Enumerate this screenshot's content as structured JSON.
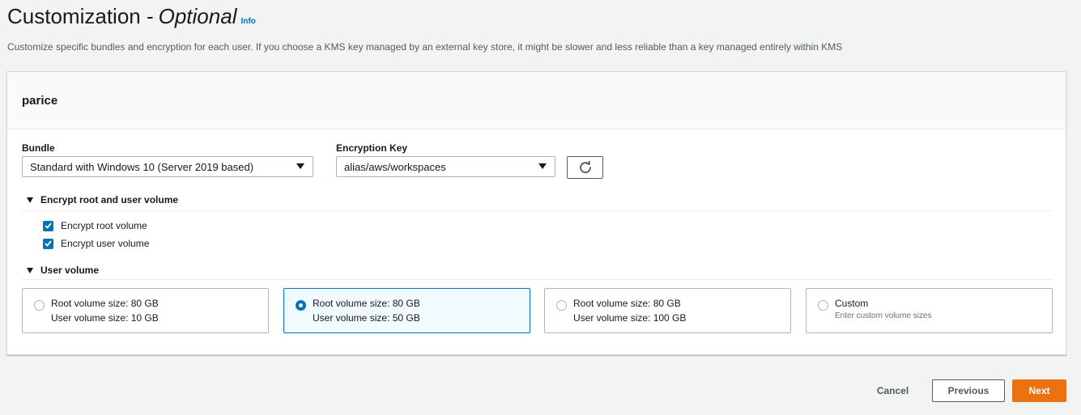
{
  "header": {
    "title": "Customization -",
    "title_optional": "Optional",
    "info_label": "Info",
    "description": "Customize specific bundles and encryption for each user. If you choose a KMS key managed by an external key store, it might be slower and less reliable than a key managed entirely within KMS"
  },
  "panel": {
    "user_name": "parice",
    "bundle": {
      "label": "Bundle",
      "value": "Standard with Windows 10 (Server 2019 based)"
    },
    "encryption_key": {
      "label": "Encryption Key",
      "value": "alias/aws/workspaces"
    },
    "encrypt_section": {
      "title": "Encrypt root and user volume",
      "expanded": true,
      "options": [
        {
          "label": "Encrypt root volume",
          "checked": true
        },
        {
          "label": "Encrypt user volume",
          "checked": true
        }
      ]
    },
    "volume_section": {
      "title": "User volume",
      "expanded": true,
      "tiles": [
        {
          "line1": "Root volume size: 80 GB",
          "line2": "User volume size: 10 GB",
          "selected": false
        },
        {
          "line1": "Root volume size: 80 GB",
          "line2": "User volume size: 50 GB",
          "selected": true
        },
        {
          "line1": "Root volume size: 80 GB",
          "line2": "User volume size: 100 GB",
          "selected": false
        },
        {
          "line1": "Custom",
          "sub": "Enter custom volume sizes",
          "selected": false
        }
      ]
    }
  },
  "footer": {
    "cancel_label": "Cancel",
    "previous_label": "Previous",
    "next_label": "Next"
  },
  "colors": {
    "accent": "#0073bb",
    "primary_button": "#ec7211",
    "selected_tile_bg": "#f1faff",
    "page_bg": "#f2f3f3"
  }
}
